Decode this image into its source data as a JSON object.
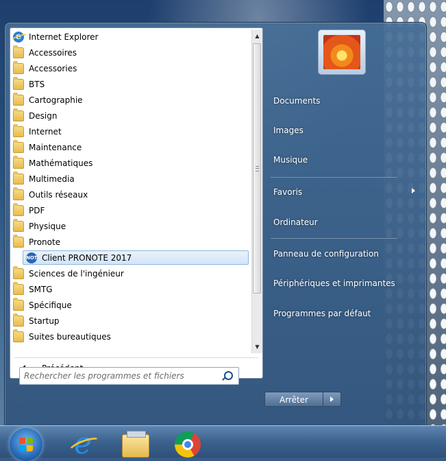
{
  "programs": [
    {
      "label": "Internet Explorer",
      "icon": "internet-explorer-icon"
    },
    {
      "label": "Accessoires",
      "icon": "folder-icon"
    },
    {
      "label": "Accessories",
      "icon": "folder-icon"
    },
    {
      "label": "BTS",
      "icon": "folder-icon"
    },
    {
      "label": "Cartographie",
      "icon": "folder-icon"
    },
    {
      "label": "Design",
      "icon": "folder-icon"
    },
    {
      "label": "Internet",
      "icon": "folder-icon"
    },
    {
      "label": "Maintenance",
      "icon": "folder-icon"
    },
    {
      "label": "Mathématiques",
      "icon": "folder-icon"
    },
    {
      "label": "Multimedia",
      "icon": "folder-icon"
    },
    {
      "label": "Outils réseaux",
      "icon": "folder-icon"
    },
    {
      "label": "PDF",
      "icon": "folder-icon"
    },
    {
      "label": "Physique",
      "icon": "folder-icon"
    },
    {
      "label": "Pronote",
      "icon": "folder-icon"
    },
    {
      "label": "Client PRONOTE 2017",
      "icon": "pronote-icon",
      "badge": "NOT",
      "selected": true
    },
    {
      "label": "Sciences de l'ingénieur",
      "icon": "folder-icon"
    },
    {
      "label": "SMTG",
      "icon": "folder-icon"
    },
    {
      "label": "Spécifique",
      "icon": "folder-icon"
    },
    {
      "label": "Startup",
      "icon": "folder-icon"
    },
    {
      "label": "Suites bureautiques",
      "icon": "folder-icon"
    }
  ],
  "back_label": "Précédent",
  "search": {
    "placeholder": "Rechercher les programmes et fichiers"
  },
  "right_items": [
    "Documents",
    "Images",
    "Musique",
    "Favoris",
    "Ordinateur",
    "Panneau de configuration",
    "Périphériques et imprimantes",
    "Programmes par défaut"
  ],
  "shutdown_label": "Arrêter",
  "taskbar": [
    "start-orb",
    "internet-explorer-icon",
    "file-explorer-icon",
    "chrome-icon"
  ],
  "colors": {
    "selection": "#d2e4f7",
    "panel_blue": "#3b628d",
    "accent": "#2a66b7"
  }
}
